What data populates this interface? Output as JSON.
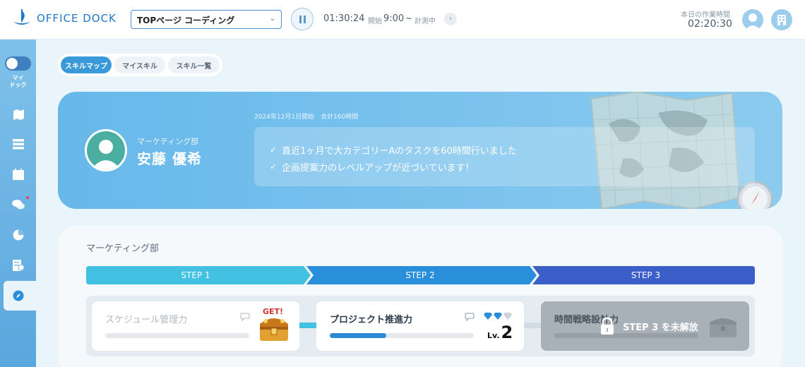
{
  "app": {
    "brand": "OFFICE DOCK"
  },
  "header": {
    "task": "TOPページ コーディング",
    "timer": "01:30:24",
    "start_label": "開始",
    "start_time": "9:00",
    "separator": "~",
    "status": "計測中",
    "work_label": "本日の作業時間",
    "work_time": "02:20:30"
  },
  "sidebar": {
    "toggle_label": "マイ\nドック",
    "icons": [
      "map-icon",
      "list-icon",
      "calendar-icon",
      "chat-icon",
      "pie-chart-icon",
      "report-icon",
      "compass-icon"
    ],
    "active": "compass-icon"
  },
  "tabs": [
    {
      "label": "スキルマップ",
      "active": true
    },
    {
      "label": "マイスキル",
      "active": false
    },
    {
      "label": "スキル一覧",
      "active": false
    }
  ],
  "hero": {
    "department": "マーケティング部",
    "name": "安藤 優希",
    "period": "2024年12月1日開始　合計160時間",
    "messages": [
      "直近1ヶ月で大カテゴリーAのタスクを60時間行いました",
      "企画提案力のレベルアップが近づいています！"
    ]
  },
  "skill_map": {
    "department": "マーケティング部",
    "steps": [
      {
        "label": "STEP 1",
        "color": "#43c1e3"
      },
      {
        "label": "STEP 2",
        "color": "#2a8fdb"
      },
      {
        "label": "STEP 3",
        "color": "#3a5fc8"
      }
    ],
    "skills": [
      {
        "name": "スケジュール管理力",
        "state": "acquired",
        "badge": "GET!",
        "progress": 0
      },
      {
        "name": "プロジェクト推進力",
        "state": "in-progress",
        "progress": 0.39,
        "level_label": "Lv.",
        "level": "2",
        "gems_filled": 2,
        "gems_total": 3
      },
      {
        "name": "時間戦略設計力",
        "state": "locked",
        "locked_text": "STEP 3 を未解放",
        "progress": 0
      }
    ]
  }
}
